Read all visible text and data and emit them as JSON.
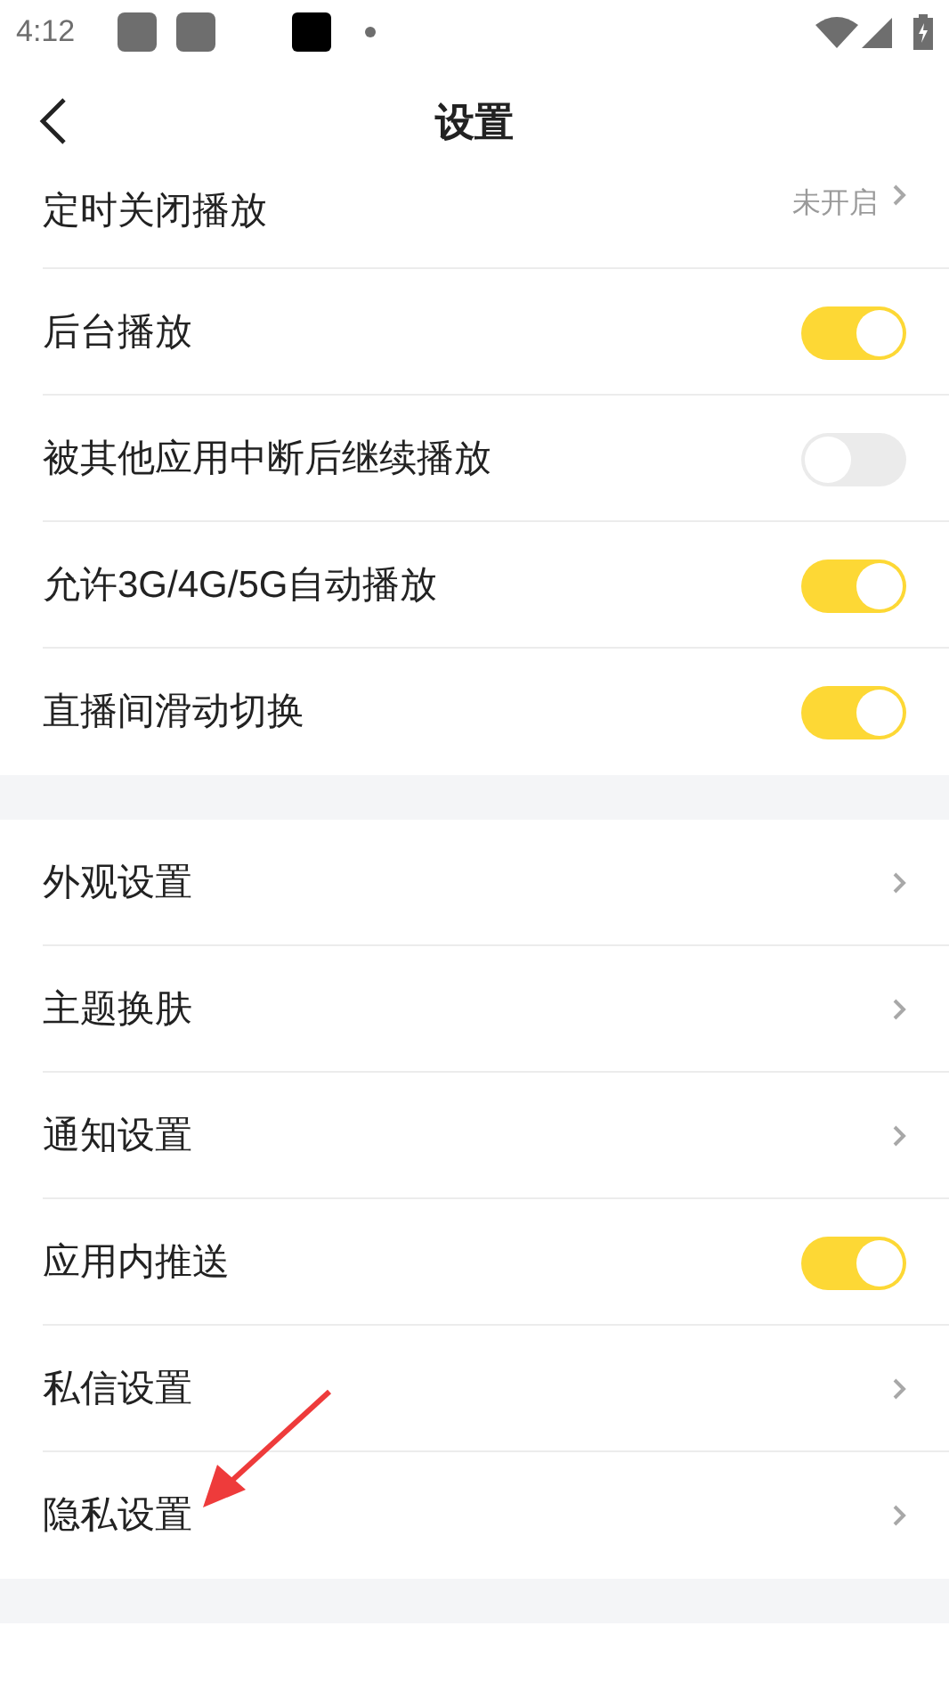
{
  "status_bar": {
    "time": "4:12"
  },
  "header": {
    "title": "设置"
  },
  "groups": [
    {
      "items": [
        {
          "kind": "value",
          "label": "定时关闭播放",
          "value": "未开启"
        },
        {
          "kind": "toggle",
          "label": "后台播放",
          "on": true
        },
        {
          "kind": "toggle",
          "label": "被其他应用中断后继续播放",
          "on": false
        },
        {
          "kind": "toggle",
          "label": "允许3G/4G/5G自动播放",
          "on": true
        },
        {
          "kind": "toggle",
          "label": "直播间滑动切换",
          "on": true
        }
      ]
    },
    {
      "items": [
        {
          "kind": "link",
          "label": "外观设置"
        },
        {
          "kind": "link",
          "label": "主题换肤"
        },
        {
          "kind": "link",
          "label": "通知设置"
        },
        {
          "kind": "toggle",
          "label": "应用内推送",
          "on": true
        },
        {
          "kind": "link",
          "label": "私信设置"
        },
        {
          "kind": "link",
          "label": "隐私设置"
        }
      ]
    }
  ]
}
